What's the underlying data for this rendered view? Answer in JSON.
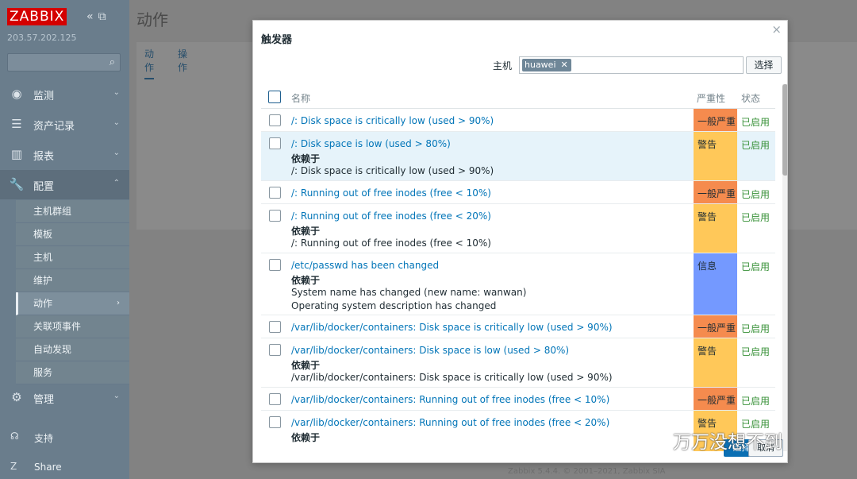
{
  "sidebar": {
    "brand": "ZABBIX",
    "server_ip": "203.57.202.125",
    "nav": [
      {
        "label": "监测",
        "icon": "eye-icon"
      },
      {
        "label": "资产记录",
        "icon": "list-icon"
      },
      {
        "label": "报表",
        "icon": "chart-icon"
      },
      {
        "label": "配置",
        "icon": "wrench-icon"
      }
    ],
    "config_sub": [
      "主机群组",
      "模板",
      "主机",
      "维护",
      "动作",
      "关联项事件",
      "自动发现",
      "服务"
    ],
    "admin": "管理",
    "support": "支持",
    "share": "Share"
  },
  "main": {
    "title": "动作",
    "tabs": [
      "动作",
      "操作"
    ],
    "footer": "Zabbix 5.4.4. © 2001–2021, Zabbix SIA"
  },
  "modal": {
    "title": "触发器",
    "host_label": "主机",
    "host_tag": "huawei",
    "select_label": "选择",
    "columns": {
      "name": "名称",
      "severity": "严重性",
      "status": "状态"
    },
    "depends_label": "依赖于",
    "rows": [
      {
        "name": "/: Disk space is critically low (used > 90%)",
        "severity": "一般严重",
        "sev_color": "#f58b4e",
        "status": "已启用",
        "deps": []
      },
      {
        "name": "/: Disk space is low (used > 80%)",
        "severity": "警告",
        "sev_color": "#ffc859",
        "status": "已启用",
        "deps": [
          "/: Disk space is critically low (used > 90%)"
        ]
      },
      {
        "name": "/: Running out of free inodes (free < 10%)",
        "severity": "一般严重",
        "sev_color": "#f58b4e",
        "status": "已启用",
        "deps": []
      },
      {
        "name": "/: Running out of free inodes (free < 20%)",
        "severity": "警告",
        "sev_color": "#ffc859",
        "status": "已启用",
        "deps": [
          "/: Running out of free inodes (free < 10%)"
        ]
      },
      {
        "name": "/etc/passwd has been changed",
        "severity": "信息",
        "sev_color": "#7499ff",
        "status": "已启用",
        "deps": [
          "System name has changed (new name: wanwan)",
          "Operating system description has changed"
        ]
      },
      {
        "name": "/var/lib/docker/containers: Disk space is critically low (used > 90%)",
        "severity": "一般严重",
        "sev_color": "#f58b4e",
        "status": "已启用",
        "deps": []
      },
      {
        "name": "/var/lib/docker/containers: Disk space is low (used > 80%)",
        "severity": "警告",
        "sev_color": "#ffc859",
        "status": "已启用",
        "deps": [
          "/var/lib/docker/containers: Disk space is critically low (used > 90%)"
        ]
      },
      {
        "name": "/var/lib/docker/containers: Running out of free inodes (free < 10%)",
        "severity": "一般严重",
        "sev_color": "#f58b4e",
        "status": "已启用",
        "deps": []
      },
      {
        "name": "/var/lib/docker/containers: Running out of free inodes (free < 20%)",
        "severity": "警告",
        "sev_color": "#ffc859",
        "status": "已启用",
        "deps": [
          "…"
        ]
      }
    ],
    "footer_select": "选择",
    "footer_cancel": "取消"
  },
  "watermark": "万万没想不到"
}
